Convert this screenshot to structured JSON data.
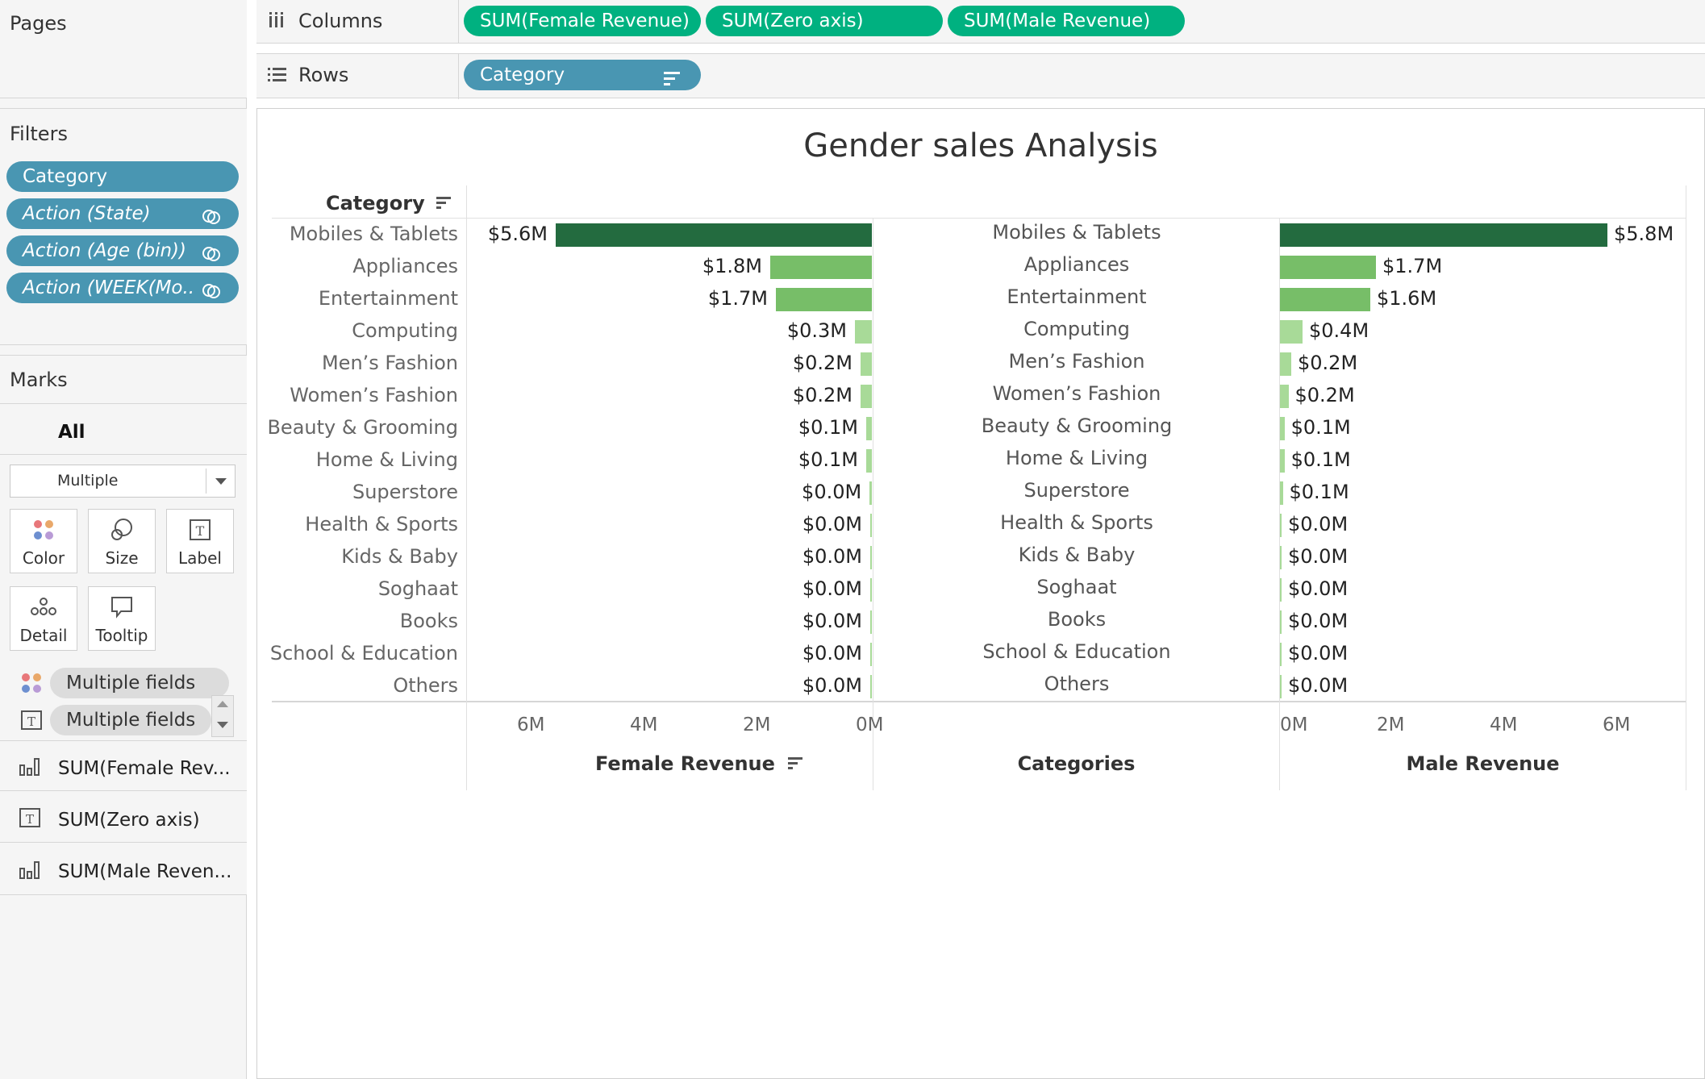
{
  "left": {
    "pages_title": "Pages",
    "filters_title": "Filters",
    "filters": [
      {
        "label": "Category",
        "italic": false,
        "linked": false
      },
      {
        "label": "Action (State)",
        "italic": true,
        "linked": true
      },
      {
        "label": "Action (Age (bin))",
        "italic": true,
        "linked": true
      },
      {
        "label": "Action (WEEK(Mo..",
        "italic": true,
        "linked": true
      }
    ],
    "marks_title": "Marks",
    "marks_all": "All",
    "mark_type": "Multiple",
    "mark_cards": {
      "color": "Color",
      "size": "Size",
      "label": "Label",
      "detail": "Detail",
      "tooltip": "Tooltip"
    },
    "mark_fields": [
      "Multiple fields",
      "Multiple fields"
    ],
    "measures": [
      "SUM(Female Rev...",
      "SUM(Zero axis)",
      "SUM(Male Reven..."
    ]
  },
  "shelves": {
    "columns_label": "Columns",
    "rows_label": "Rows",
    "columns_pills": [
      "SUM(Female Revenue)",
      "SUM(Zero axis)",
      "SUM(Male Revenue)"
    ],
    "rows_pills": [
      "Category"
    ]
  },
  "chart_data": {
    "type": "bar",
    "title": "Gender sales Analysis",
    "row_header": "Category",
    "categories": [
      "Mobiles & Tablets",
      "Appliances",
      "Entertainment",
      "Computing",
      "Men’s Fashion",
      "Women’s Fashion",
      "Beauty & Grooming",
      "Home & Living",
      "Superstore",
      "Health & Sports",
      "Kids & Baby",
      "Soghaat",
      "Books",
      "School & Education",
      "Others"
    ],
    "series": [
      {
        "name": "Female Revenue",
        "unit": "M",
        "values": [
          5.6,
          1.8,
          1.7,
          0.3,
          0.2,
          0.2,
          0.1,
          0.1,
          0.04,
          0.02,
          0.01,
          0.005,
          0.003,
          0.002,
          0.001
        ],
        "labels": [
          "$5.6M",
          "$1.8M",
          "$1.7M",
          "$0.3M",
          "$0.2M",
          "$0.2M",
          "$0.1M",
          "$0.1M",
          "$0.0M",
          "$0.0M",
          "$0.0M",
          "$0.0M",
          "$0.0M",
          "$0.0M",
          "$0.0M"
        ]
      },
      {
        "name": "Male Revenue",
        "unit": "M",
        "values": [
          5.8,
          1.7,
          1.6,
          0.4,
          0.2,
          0.15,
          0.08,
          0.08,
          0.05,
          0.02,
          0.01,
          0.005,
          0.003,
          0.002,
          0.001
        ],
        "labels": [
          "$5.8M",
          "$1.7M",
          "$1.6M",
          "$0.4M",
          "$0.2M",
          "$0.2M",
          "$0.1M",
          "$0.1M",
          "$0.1M",
          "$0.0M",
          "$0.0M",
          "$0.0M",
          "$0.0M",
          "$0.0M",
          "$0.0M"
        ]
      }
    ],
    "female_axis": {
      "title": "Female Revenue",
      "ticks": [
        "6M",
        "4M",
        "2M",
        "0M"
      ],
      "reversed": true,
      "xlim": [
        0,
        6.5
      ]
    },
    "middle_axis": {
      "title": "Categories"
    },
    "male_axis": {
      "title": "Male Revenue",
      "ticks": [
        "0M",
        "2M",
        "4M",
        "6M"
      ],
      "xlim": [
        0,
        6.5
      ]
    },
    "colors": {
      "dark": "#236b3f",
      "mid": "#77be68",
      "light": "#a8da98"
    }
  }
}
